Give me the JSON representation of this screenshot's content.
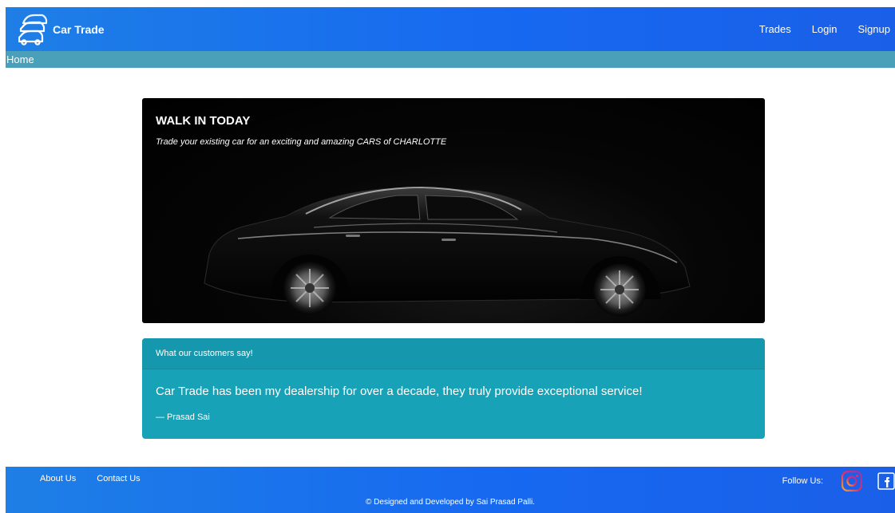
{
  "header": {
    "brand": "Car Trade",
    "logo_icon": "car-stack-icon",
    "nav": [
      {
        "label": "Trades"
      },
      {
        "label": "Login"
      },
      {
        "label": "Signup"
      }
    ]
  },
  "breadcrumb": {
    "home": "Home"
  },
  "hero": {
    "title": "WALK IN TODAY",
    "subtitle": "Trade your existing car for an exciting and amazing CARS of CHARLOTTE",
    "image_icon": "car-icon"
  },
  "testimonial": {
    "header": "What our customers say!",
    "quote": "Car Trade has been my dealership for over a decade, they truly provide exceptional service!",
    "author": "— Prasad Sai"
  },
  "footer": {
    "links": [
      {
        "label": "About Us"
      },
      {
        "label": "Contact Us"
      }
    ],
    "follow_label": "Follow Us:",
    "social": [
      "instagram-icon",
      "facebook-icon"
    ],
    "copyright": "© Designed and Developed by Sai Prasad Palli."
  },
  "colors": {
    "header_gradient_start": "#1e7fe6",
    "header_gradient_end": "#1a5fe8",
    "subbar": "#4a9fb9",
    "testimonial_bg": "#17a2b8",
    "hero_bg": "#000000"
  }
}
